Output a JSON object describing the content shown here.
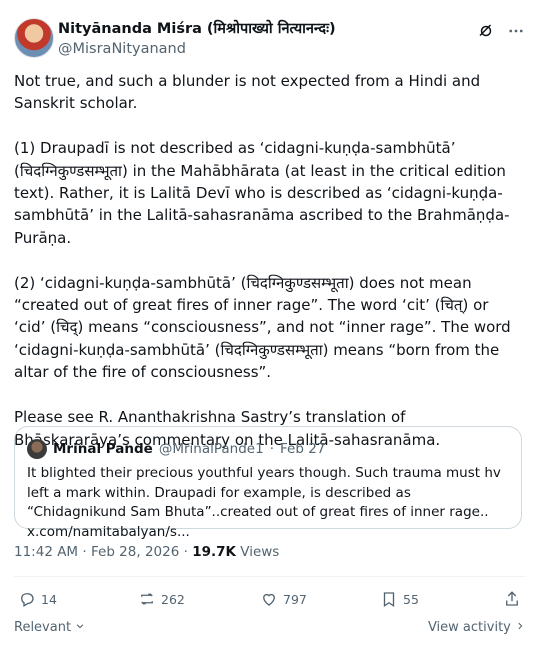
{
  "author": {
    "name": "Nityānanda Miśra (मिश्रोपाख्यो नित्यानन्दः)",
    "handle": "@MisraNityanand"
  },
  "tweet": {
    "text": "Not true, and such a blunder is not expected from a Hindi and Sanskrit scholar.\n\n(1) Draupadī is not described as ‘cidagni-kuṇḍa-sambhūtā’ (चिदग्निकुण्डसम्भूता) in the Mahābhārata (at least in the critical edition text). Rather, it is Lalitā Devī who is described as ‘cidagni-kuṇḍa-sambhūtā’ in the Lalitā-sahasranāma ascribed to the Brahmāṇḍa-Purāṇa.\n\n(2) ‘cidagni-kuṇḍa-sambhūtā’ (चिदग्निकुण्डसम्भूता) does not mean “created out of great fires of inner rage”. The word ‘cit’ (चित्) or ‘cid’ (चिद्) means “consciousness”, and not “inner rage”. The word ‘cidagni-kuṇḍa-sambhūtā’ (चिदग्निकुण्डसम्भूता) means “born from the altar of the fire of consciousness”.\n\nPlease see R. Ananthakrishna Sastry’s translation of Bhāskararāya’s commentary on the Lalitā-sahasranāma."
  },
  "quote": {
    "name": "Mrinal Pande",
    "handle": "@MrinalPande1",
    "separator": "·",
    "date": "Feb 27",
    "text": "It blighted their precious youthful years though. Such trauma must hv left a mark within. Draupadi for example, is described as “Chidagnikund Sam Bhuta”..created out of great fires of inner rage.. x.com/namitabalyan/s..."
  },
  "meta": {
    "time": "11:42 AM",
    "separator": "·",
    "date": "Feb 28, 2026",
    "views_count": "19.7K",
    "views_label": "Views"
  },
  "actions": {
    "replies": "14",
    "reposts": "262",
    "likes": "797",
    "bookmarks": "55"
  },
  "footer": {
    "sort_label": "Relevant",
    "view_activity": "View activity"
  },
  "icons": [
    "grok-icon",
    "more-icon",
    "reply-icon",
    "repost-icon",
    "like-icon",
    "bookmark-icon",
    "share-icon",
    "chevron-down-icon",
    "chevron-right-icon"
  ]
}
